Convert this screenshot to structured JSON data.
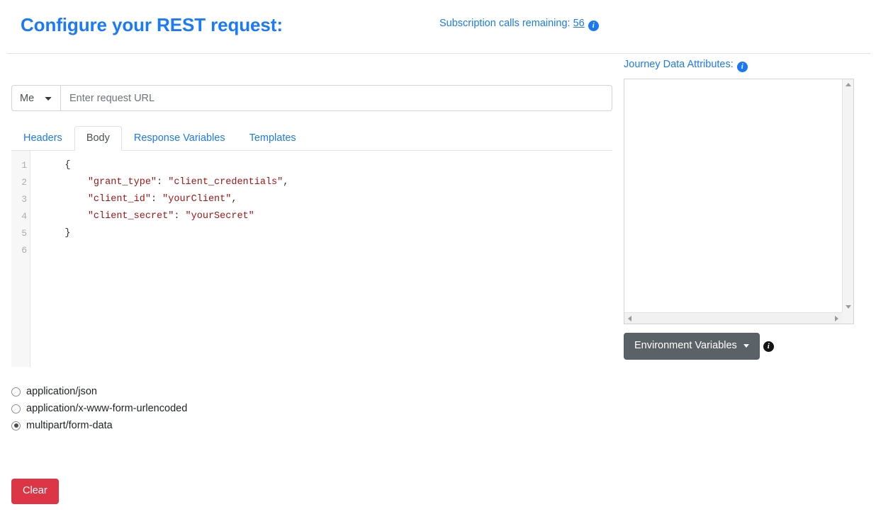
{
  "header": {
    "title": "Configure your REST request:",
    "subscription_label": "Subscription calls remaining:",
    "subscription_count": "56",
    "subscription_info_icon": "info-icon"
  },
  "request": {
    "method_value": "Me",
    "method_options": [
      "Me"
    ],
    "url_placeholder": "Enter request URL",
    "url_value": ""
  },
  "tabs": [
    {
      "label": "Headers",
      "active": false
    },
    {
      "label": "Body",
      "active": true
    },
    {
      "label": "Response Variables",
      "active": false
    },
    {
      "label": "Templates",
      "active": false
    }
  ],
  "editor": {
    "line_numbers": [
      "1",
      "2",
      "3",
      "4",
      "5",
      "6"
    ],
    "lines": [
      "    {",
      "        \"grant_type\": \"client_credentials\",",
      "        \"client_id\": \"yourClient\",",
      "        \"client_secret\": \"yourSecret\"",
      "    }",
      ""
    ],
    "body_text": "    {\n        \"grant_type\": \"client_credentials\",\n        \"client_id\": \"yourClient\",\n        \"client_secret\": \"yourSecret\"\n    }\n"
  },
  "content_type": {
    "options": [
      {
        "label": "application/json",
        "selected": false
      },
      {
        "label": "application/x-www-form-urlencoded",
        "selected": false
      },
      {
        "label": "multipart/form-data",
        "selected": true
      }
    ]
  },
  "actions": {
    "clear_label": "Clear"
  },
  "right_panel": {
    "journey_label": "Journey Data Attributes:",
    "journey_info_icon": "info-icon",
    "journey_value": "",
    "env_button_label": "Environment Variables",
    "env_info_icon": "info-icon"
  },
  "colors": {
    "accent_blue": "#1a7af8",
    "danger_red": "#dc3545",
    "secondary_gray": "#5a6268",
    "code_string": "#a31515"
  }
}
